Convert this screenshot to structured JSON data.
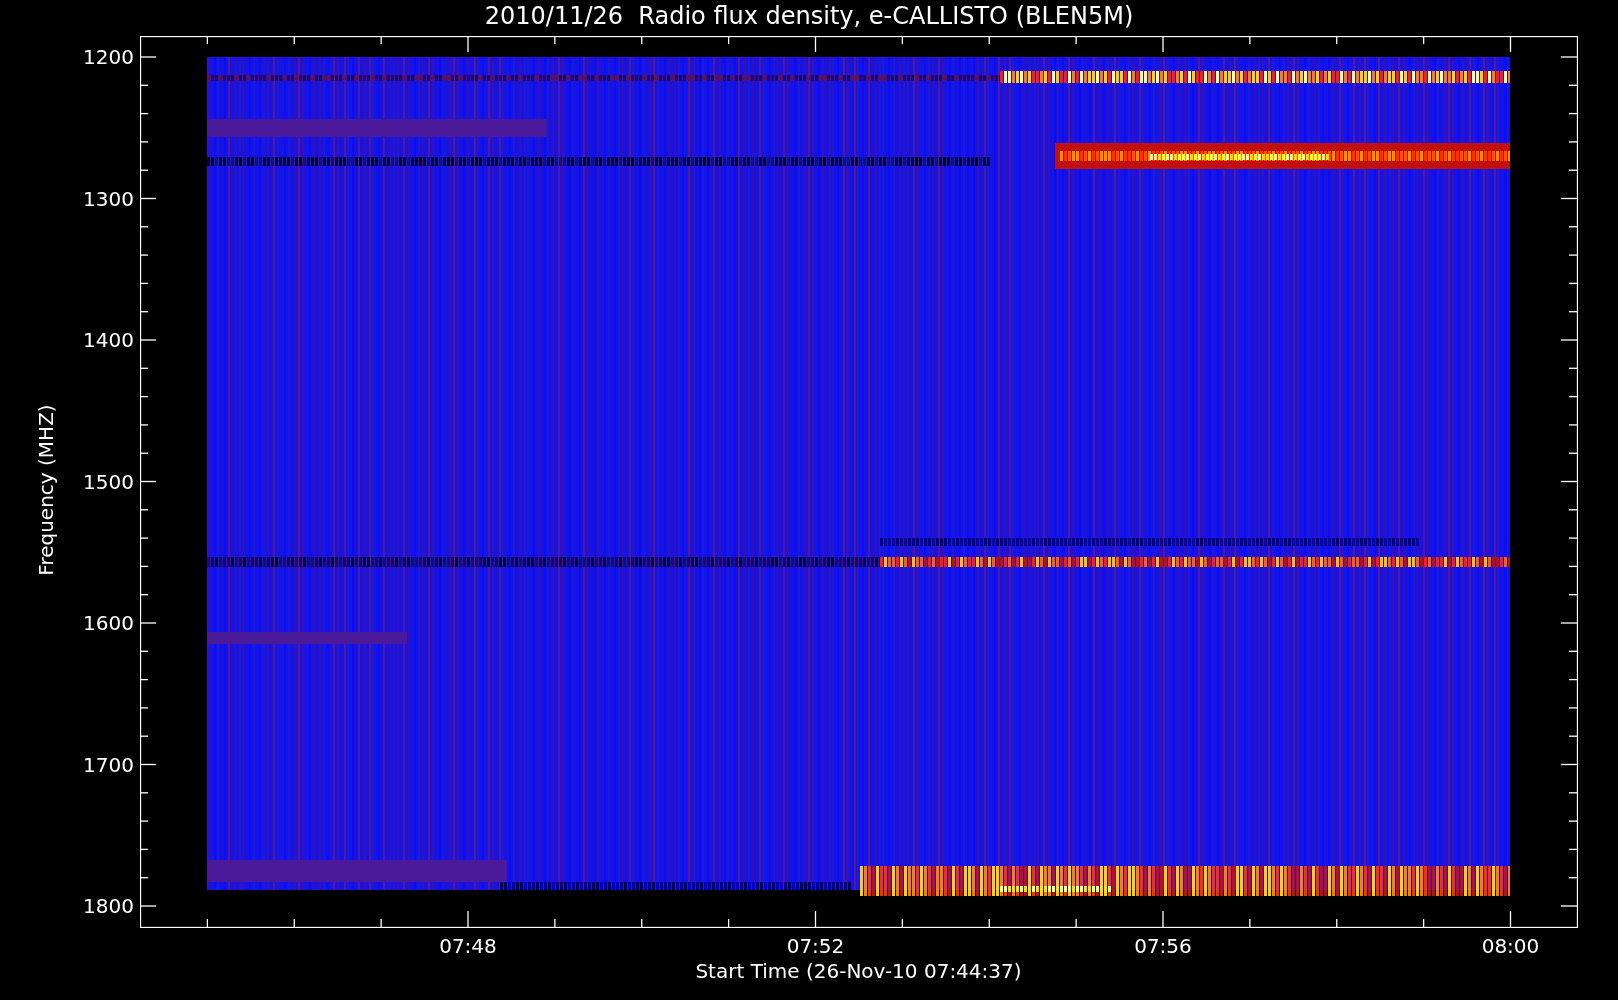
{
  "title": "2010/11/26  Radio flux density, e-CALLISTO (BLEN5M)",
  "y_axis": {
    "label": "Frequency (MHZ)",
    "ticks": [
      "1200",
      "1300",
      "1400",
      "1500",
      "1600",
      "1700",
      "1800"
    ]
  },
  "x_axis": {
    "label": "Start Time (26-Nov-10 07:44:37)",
    "ticks": [
      "07:48",
      "07:52",
      "07:56",
      "08:00"
    ]
  }
}
